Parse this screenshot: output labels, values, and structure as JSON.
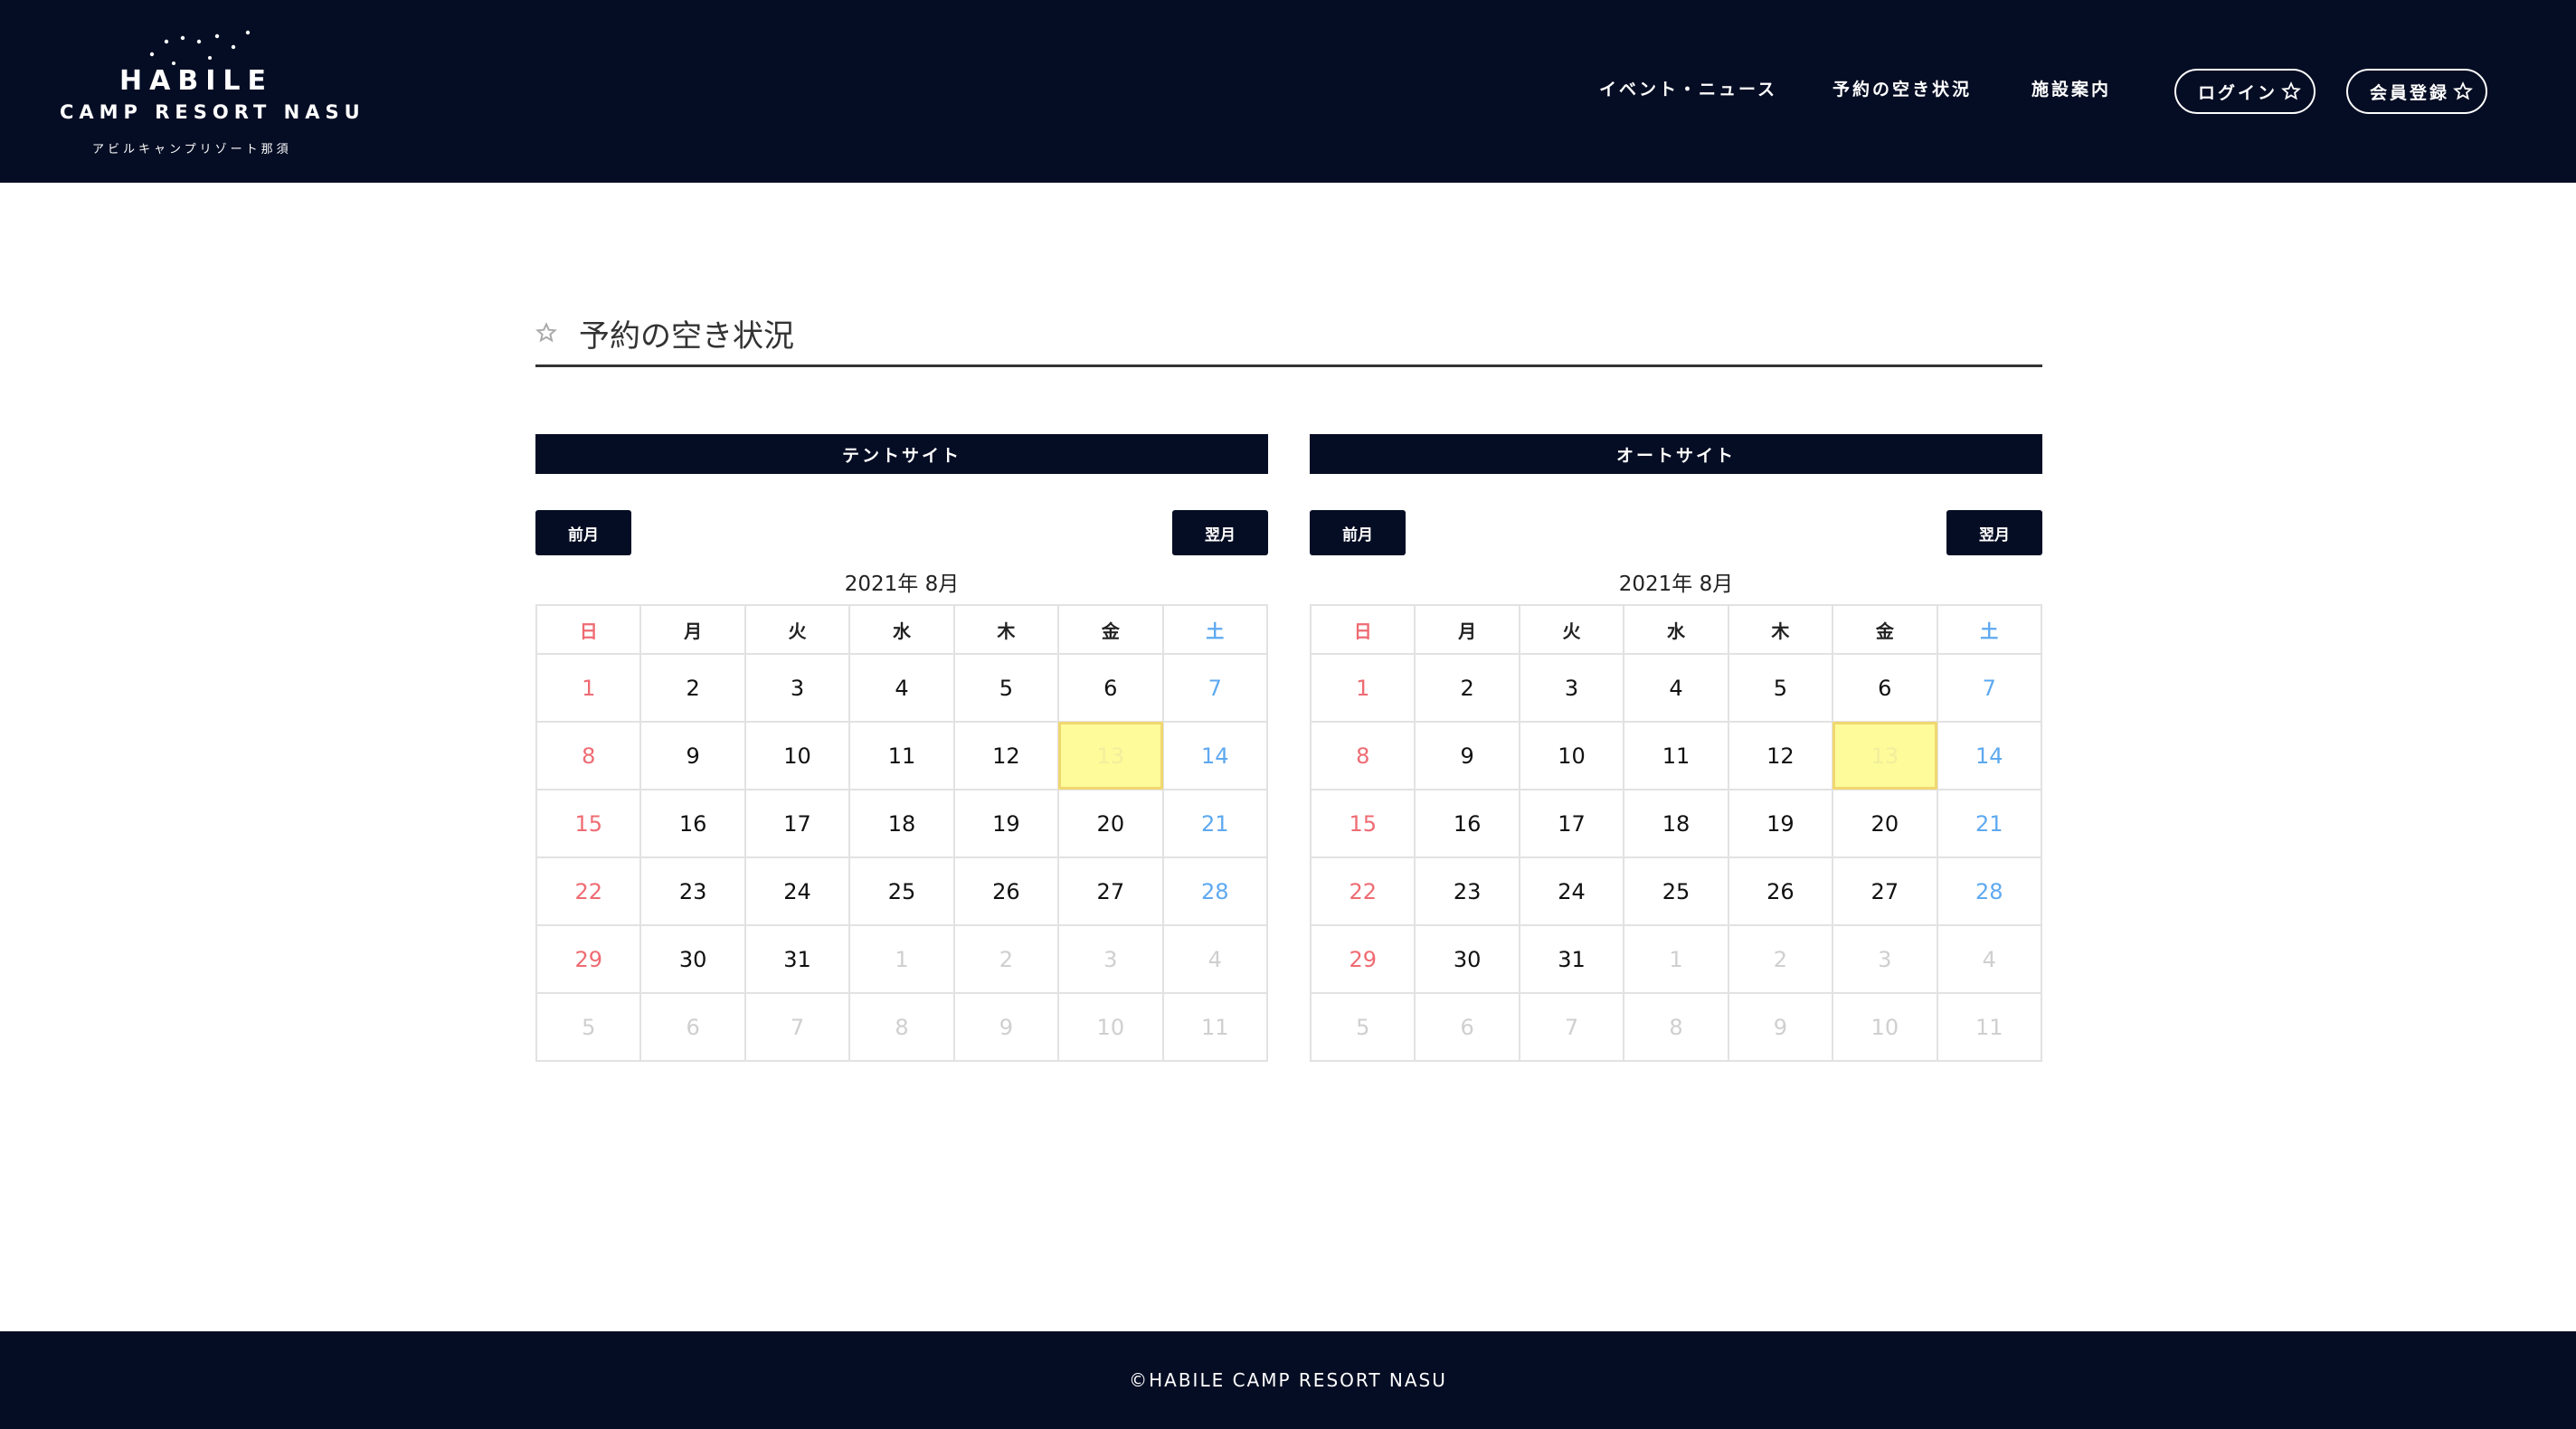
{
  "brand": {
    "name": "HABILE",
    "subtitle": "CAMP RESORT NASU",
    "kana": "アビルキャンプリゾート那須"
  },
  "nav": {
    "events": "イベント・ニュース",
    "availability": "予約の空き状況",
    "facilities": "施設案内",
    "login": "ログイン",
    "register": "会員登録"
  },
  "page": {
    "title": "予約の空き状況"
  },
  "weekdays": [
    "日",
    "月",
    "火",
    "水",
    "木",
    "金",
    "土"
  ],
  "calendars": [
    {
      "title": "テントサイト",
      "prev_label": "前月",
      "next_label": "翌月",
      "month_label": "2021年 8月"
    },
    {
      "title": "オートサイト",
      "prev_label": "前月",
      "next_label": "翌月",
      "month_label": "2021年 8月"
    }
  ],
  "calendar_days": [
    [
      {
        "d": "1",
        "t": "sun"
      },
      {
        "d": "2",
        "t": "day"
      },
      {
        "d": "3",
        "t": "day"
      },
      {
        "d": "4",
        "t": "day"
      },
      {
        "d": "5",
        "t": "day"
      },
      {
        "d": "6",
        "t": "day"
      },
      {
        "d": "7",
        "t": "sat"
      }
    ],
    [
      {
        "d": "8",
        "t": "sun"
      },
      {
        "d": "9",
        "t": "day"
      },
      {
        "d": "10",
        "t": "day"
      },
      {
        "d": "11",
        "t": "day"
      },
      {
        "d": "12",
        "t": "day"
      },
      {
        "d": "13",
        "t": "today"
      },
      {
        "d": "14",
        "t": "sat"
      }
    ],
    [
      {
        "d": "15",
        "t": "sun"
      },
      {
        "d": "16",
        "t": "day"
      },
      {
        "d": "17",
        "t": "day"
      },
      {
        "d": "18",
        "t": "day"
      },
      {
        "d": "19",
        "t": "day"
      },
      {
        "d": "20",
        "t": "day"
      },
      {
        "d": "21",
        "t": "sat"
      }
    ],
    [
      {
        "d": "22",
        "t": "sun"
      },
      {
        "d": "23",
        "t": "day"
      },
      {
        "d": "24",
        "t": "day"
      },
      {
        "d": "25",
        "t": "day"
      },
      {
        "d": "26",
        "t": "day"
      },
      {
        "d": "27",
        "t": "day"
      },
      {
        "d": "28",
        "t": "sat"
      }
    ],
    [
      {
        "d": "29",
        "t": "sun"
      },
      {
        "d": "30",
        "t": "day"
      },
      {
        "d": "31",
        "t": "day"
      },
      {
        "d": "1",
        "t": "other"
      },
      {
        "d": "2",
        "t": "other"
      },
      {
        "d": "3",
        "t": "other"
      },
      {
        "d": "4",
        "t": "other"
      }
    ],
    [
      {
        "d": "5",
        "t": "other"
      },
      {
        "d": "6",
        "t": "other"
      },
      {
        "d": "7",
        "t": "other"
      },
      {
        "d": "8",
        "t": "other"
      },
      {
        "d": "9",
        "t": "other"
      },
      {
        "d": "10",
        "t": "other"
      },
      {
        "d": "11",
        "t": "other"
      }
    ]
  ],
  "footer": {
    "copyright": "©HABILE CAMP RESORT NASU"
  },
  "colors": {
    "navy": "#050d24",
    "sunday": "#ef6b73",
    "saturday": "#5ea9f0",
    "today_highlight": "#fdfb9a"
  },
  "icons": {
    "star": "star-outline-icon"
  }
}
